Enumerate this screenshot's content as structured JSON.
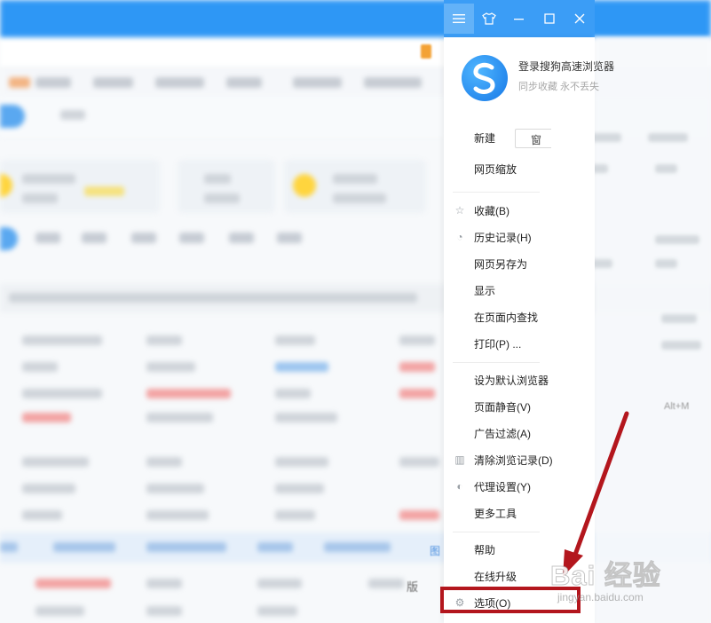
{
  "window_controls": {
    "menu_icon": "hamburger-icon",
    "skin_icon": "tshirt-icon",
    "minimize_icon": "minimize-icon",
    "maximize_icon": "maximize-icon",
    "close_icon": "close-icon"
  },
  "login": {
    "title": "登录搜狗高速浏览器",
    "subtitle": "同步收藏 永不丢失"
  },
  "menu": {
    "new_label": "新建",
    "new_window_label": "窗",
    "zoom_label": "网页缩放",
    "favorites_label": "收藏(B)",
    "history_label": "历史记录(H)",
    "save_as_label": "网页另存为",
    "display_label": "显示",
    "find_label": "在页面内查找",
    "print_label": "打印(P) ...",
    "default_browser_label": "设为默认浏览器",
    "mute_label": "页面静音(V)",
    "ad_filter_label": "广告过滤(A)",
    "clear_history_label": "清除浏览记录(D)",
    "proxy_label": "代理设置(Y)",
    "more_tools_label": "更多工具",
    "help_label": "帮助",
    "upgrade_label": "在线升级",
    "options_label": "选项(O)",
    "mute_shortcut": "Alt+M"
  },
  "background": {
    "version_text": "版",
    "side_text": "图"
  },
  "watermark": {
    "main": "Bai 经验",
    "sub": "jingyan.baidu.com"
  },
  "colors": {
    "titlebar": "#2e97f5",
    "highlight": "#b3161d"
  }
}
